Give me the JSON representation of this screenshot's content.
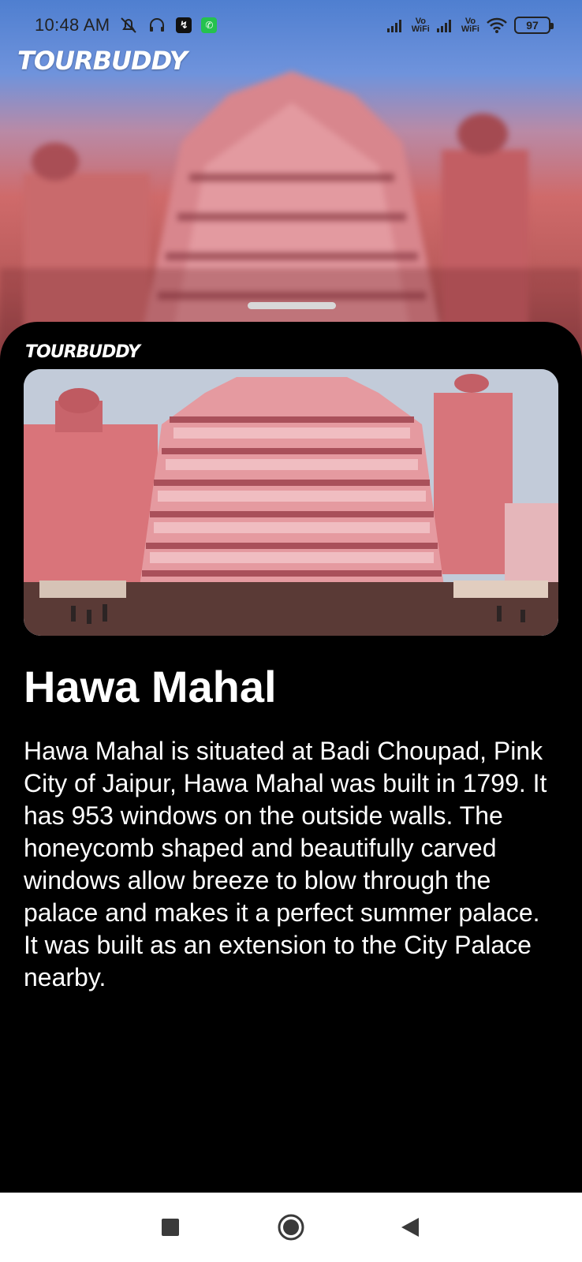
{
  "status_bar": {
    "time": "10:48 AM",
    "signal_label_1": "Vo\nWiFi",
    "signal_label_2": "Vo\nWiFi",
    "battery": "97",
    "icons": [
      "mute-icon",
      "headphones-icon",
      "app-notification-icon",
      "whatsapp-icon",
      "signal-icon",
      "signal-icon",
      "wifi-icon",
      "battery-icon"
    ]
  },
  "header": {
    "logo": "TOURBUDDY"
  },
  "sheet": {
    "logo": "TOURBUDDY",
    "place_title": "Hawa Mahal",
    "description": "Hawa Mahal is situated at Badi Choupad, Pink City of Jaipur, Hawa Mahal was built in 1799. It has 953 windows on the outside walls. The honeycomb shaped and beautifully carved windows allow breeze to blow through the palace and makes it a perfect summer palace. It was built as an extension to the City Palace nearby."
  },
  "nav_bar": {
    "buttons": [
      "recents-button",
      "home-button",
      "back-button"
    ]
  },
  "colors": {
    "sheet_background": "#000000",
    "text": "#ffffff",
    "palace_pink": "#d9828a",
    "nav_background": "#ffffff"
  }
}
